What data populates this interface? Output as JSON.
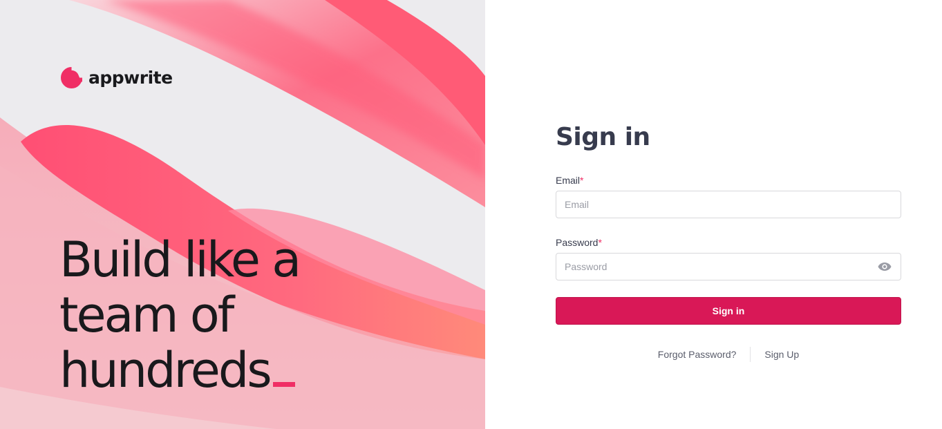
{
  "brand": {
    "name": "appwrite",
    "accent": "#f02e65"
  },
  "hero": {
    "tagline_lines": [
      "Build like a",
      "team of",
      "hundreds"
    ]
  },
  "signin": {
    "title": "Sign in",
    "email_label": "Email",
    "email_placeholder": "Email",
    "password_label": "Password",
    "password_placeholder": "Password",
    "required_mark": "*",
    "submit_label": "Sign in",
    "forgot_label": "Forgot Password?",
    "signup_label": "Sign Up",
    "button_color": "#d91857"
  }
}
